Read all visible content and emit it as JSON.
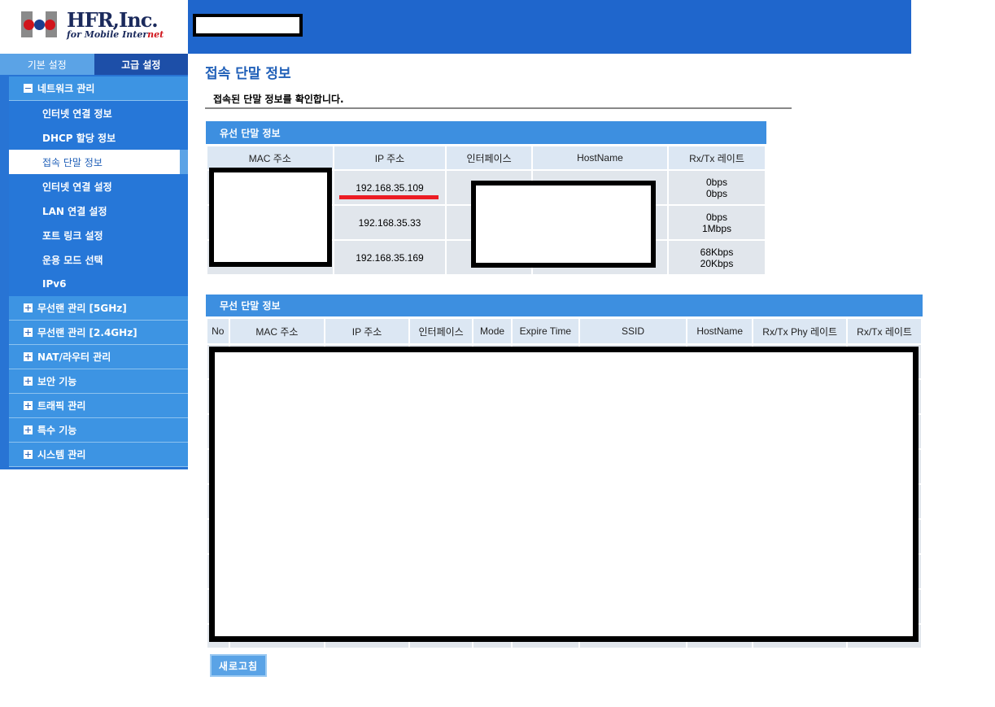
{
  "brand": {
    "name": "HFR,Inc.",
    "tagline_a": "for Mobile ",
    "tagline_b": "Inter",
    "tagline_c": "net"
  },
  "sidebar": {
    "tabs": [
      {
        "label": "기본 설정"
      },
      {
        "label": "고급 설정"
      }
    ],
    "items": [
      {
        "label": "네트워크 관리"
      },
      {
        "label": "인터넷 연결 정보"
      },
      {
        "label": "DHCP 할당 정보"
      },
      {
        "label": "접속 단말 정보"
      },
      {
        "label": "인터넷 연결 설정"
      },
      {
        "label": "LAN 연결 설정"
      },
      {
        "label": "포트 링크 설정"
      },
      {
        "label": "운용 모드 선택"
      },
      {
        "label": "IPv6"
      },
      {
        "label": "무선랜 관리 [5GHz]"
      },
      {
        "label": "무선랜 관리 [2.4GHz]"
      },
      {
        "label": "NAT/라우터 관리"
      },
      {
        "label": "보안 기능"
      },
      {
        "label": "트래픽 관리"
      },
      {
        "label": "특수 기능"
      },
      {
        "label": "시스템 관리"
      }
    ]
  },
  "main": {
    "title": "접속 단말 정보",
    "description": "접속된 단말 정보를 확인합니다.",
    "wired": {
      "heading": "유선 단말 정보",
      "columns": [
        "MAC 주소",
        "IP 주소",
        "인터페이스",
        "HostName",
        "Rx/Tx 레이트"
      ],
      "rows": [
        {
          "ip": "192.168.35.109",
          "rx": "0bps",
          "tx": "0bps"
        },
        {
          "ip": "192.168.35.33",
          "rx": "0bps",
          "tx": "1Mbps"
        },
        {
          "ip": "192.168.35.169",
          "rx": "68Kbps",
          "tx": "20Kbps"
        }
      ]
    },
    "wireless": {
      "heading": "무선 단말 정보",
      "columns": [
        "No",
        "MAC 주소",
        "IP 주소",
        "인터페이스",
        "Mode",
        "Expire Time",
        "SSID",
        "HostName",
        "Rx/Tx Phy 레이트",
        "Rx/Tx 레이트"
      ]
    },
    "refresh_label": "새로고침"
  }
}
